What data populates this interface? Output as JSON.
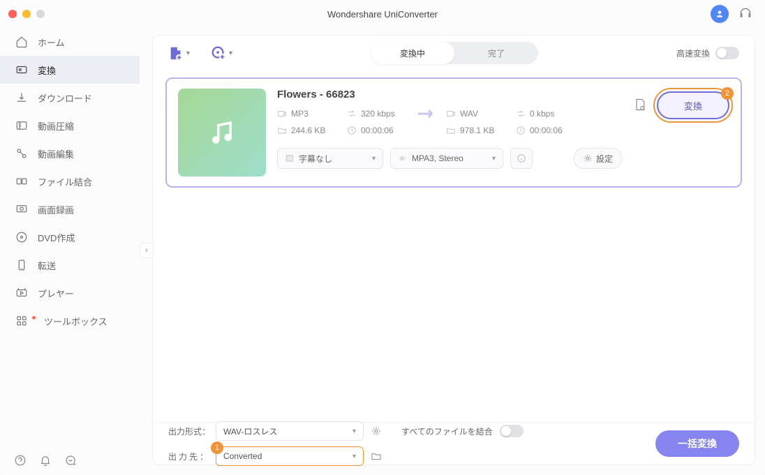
{
  "app_title": "Wondershare UniConverter",
  "sidebar": {
    "items": [
      {
        "label": "ホーム"
      },
      {
        "label": "変換"
      },
      {
        "label": "ダウンロード"
      },
      {
        "label": "動画圧縮"
      },
      {
        "label": "動画編集"
      },
      {
        "label": "ファイル結合"
      },
      {
        "label": "画面録画"
      },
      {
        "label": "DVD作成"
      },
      {
        "label": "転送"
      },
      {
        "label": "プレヤー"
      },
      {
        "label": "ツールボックス"
      }
    ]
  },
  "toolbar": {
    "tabs": {
      "converting": "変換中",
      "done": "完了"
    },
    "high_speed_label": "高速変換"
  },
  "file": {
    "title": "Flowers - 66823",
    "src": {
      "format": "MP3",
      "bitrate": "320 kbps",
      "size": "244.6 KB",
      "duration": "00:00:06"
    },
    "dst": {
      "format": "WAV",
      "bitrate": "0 kbps",
      "size": "978.1 KB",
      "duration": "00:00:06"
    },
    "subtitle_label": "字幕なし",
    "audio_label": "MPA3, Stereo",
    "settings_label": "設定",
    "convert_label": "変換",
    "badge2": "2"
  },
  "bottom": {
    "out_format_label": "出力形式：",
    "out_format_value": "WAV-ロスレス",
    "out_path_label": "出力先：",
    "out_path_value": "Converted",
    "merge_label": "すべてのファイルを結合",
    "batch_convert_label": "一括変換",
    "badge1": "1"
  }
}
